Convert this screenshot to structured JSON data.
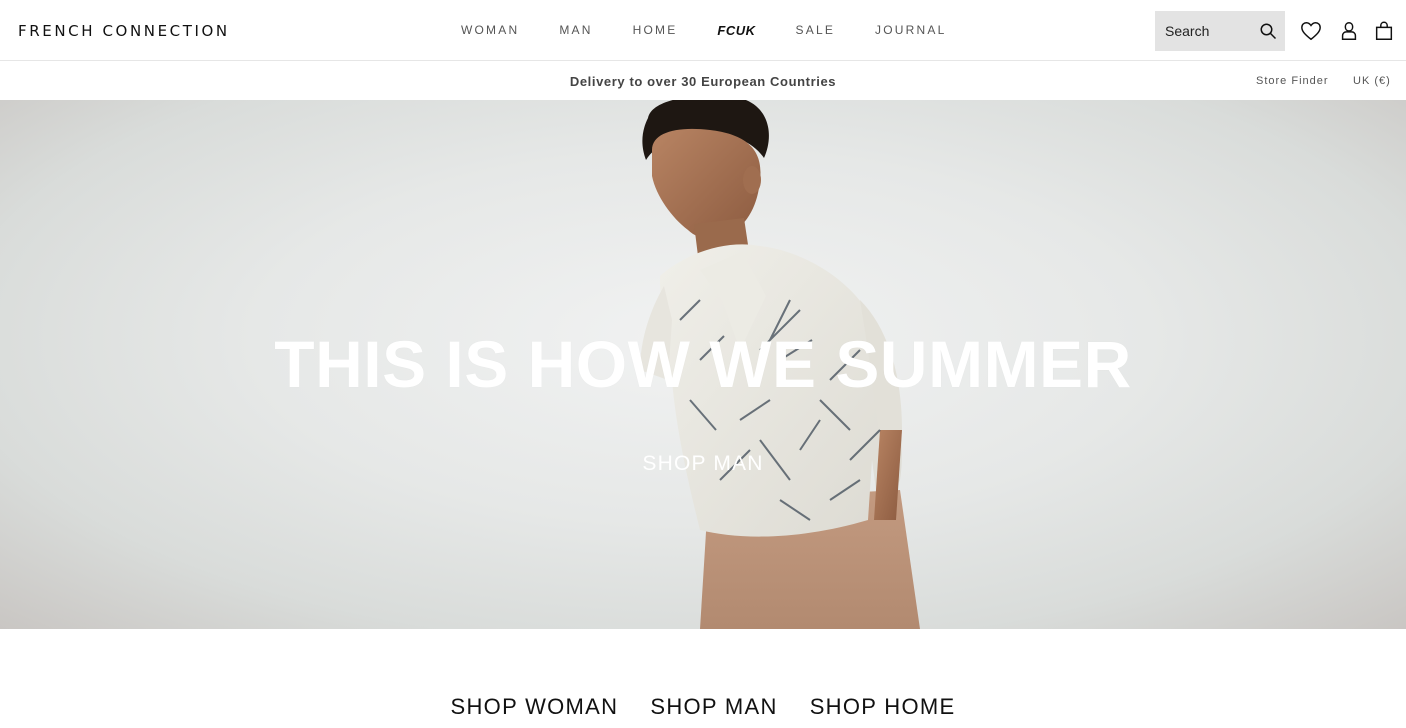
{
  "header": {
    "logo": "FRENCH CONNECTION",
    "nav": [
      {
        "label": "WOMAN"
      },
      {
        "label": "MAN"
      },
      {
        "label": "HOME"
      },
      {
        "label": "FCUK"
      },
      {
        "label": "SALE"
      },
      {
        "label": "JOURNAL"
      }
    ],
    "search": {
      "placeholder": "Search"
    },
    "icons": [
      "search-icon",
      "heart-icon",
      "user-icon",
      "shopping-bag-icon"
    ]
  },
  "subbar": {
    "delivery": "Delivery to over 30 European Countries",
    "store_finder": "Store Finder",
    "locale": "UK (€)"
  },
  "hero": {
    "title": "THIS IS HOW WE SUMMER",
    "cta": "SHOP MAN"
  },
  "categories": [
    {
      "label": "SHOP WOMAN"
    },
    {
      "label": "SHOP MAN"
    },
    {
      "label": "SHOP HOME"
    }
  ],
  "colors": {
    "text": "#111111",
    "search_bg": "#e3e3e3",
    "hero_text": "#ffffff"
  }
}
